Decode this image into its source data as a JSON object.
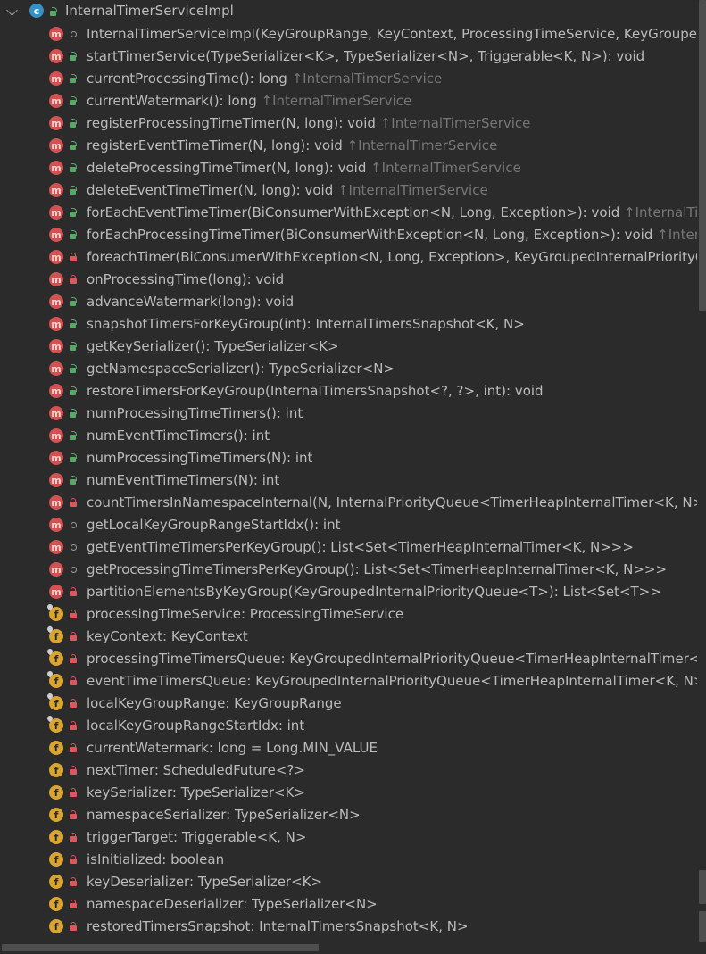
{
  "root": {
    "label": "InternalTimerServiceImpl",
    "icon": "class-icon",
    "icon_letter": "c"
  },
  "members": [
    {
      "kind": "m",
      "vis": "package",
      "sig": "InternalTimerServiceImpl(KeyGroupRange, KeyContext, ProcessingTimeService, KeyGroupedInt",
      "inh": ""
    },
    {
      "kind": "m",
      "vis": "public",
      "sig": "startTimerService(TypeSerializer<K>, TypeSerializer<N>, Triggerable<K, N>): void",
      "inh": ""
    },
    {
      "kind": "m",
      "vis": "public",
      "sig": "currentProcessingTime(): long ",
      "inh": "↑InternalTimerService"
    },
    {
      "kind": "m",
      "vis": "public",
      "sig": "currentWatermark(): long ",
      "inh": "↑InternalTimerService"
    },
    {
      "kind": "m",
      "vis": "public",
      "sig": "registerProcessingTimeTimer(N, long): void ",
      "inh": "↑InternalTimerService"
    },
    {
      "kind": "m",
      "vis": "public",
      "sig": "registerEventTimeTimer(N, long): void ",
      "inh": "↑InternalTimerService"
    },
    {
      "kind": "m",
      "vis": "public",
      "sig": "deleteProcessingTimeTimer(N, long): void ",
      "inh": "↑InternalTimerService"
    },
    {
      "kind": "m",
      "vis": "public",
      "sig": "deleteEventTimeTimer(N, long): void ",
      "inh": "↑InternalTimerService"
    },
    {
      "kind": "m",
      "vis": "public",
      "sig": "forEachEventTimeTimer(BiConsumerWithException<N, Long, Exception>): void ",
      "inh": "↑InternalTimerSe"
    },
    {
      "kind": "m",
      "vis": "public",
      "sig": "forEachProcessingTimeTimer(BiConsumerWithException<N, Long, Exception>): void ",
      "inh": "↑InternalTi"
    },
    {
      "kind": "m",
      "vis": "private",
      "sig": "foreachTimer(BiConsumerWithException<N, Long, Exception>, KeyGroupedInternalPriorityQue",
      "inh": ""
    },
    {
      "kind": "m",
      "vis": "private",
      "sig": "onProcessingTime(long): void",
      "inh": ""
    },
    {
      "kind": "m",
      "vis": "public",
      "sig": "advanceWatermark(long): void",
      "inh": ""
    },
    {
      "kind": "m",
      "vis": "public",
      "sig": "snapshotTimersForKeyGroup(int): InternalTimersSnapshot<K, N>",
      "inh": ""
    },
    {
      "kind": "m",
      "vis": "public",
      "sig": "getKeySerializer(): TypeSerializer<K>",
      "inh": ""
    },
    {
      "kind": "m",
      "vis": "public",
      "sig": "getNamespaceSerializer(): TypeSerializer<N>",
      "inh": ""
    },
    {
      "kind": "m",
      "vis": "public",
      "sig": "restoreTimersForKeyGroup(InternalTimersSnapshot<?, ?>, int): void",
      "inh": ""
    },
    {
      "kind": "m",
      "vis": "public",
      "sig": "numProcessingTimeTimers(): int",
      "inh": ""
    },
    {
      "kind": "m",
      "vis": "public",
      "sig": "numEventTimeTimers(): int",
      "inh": ""
    },
    {
      "kind": "m",
      "vis": "public",
      "sig": "numProcessingTimeTimers(N): int",
      "inh": ""
    },
    {
      "kind": "m",
      "vis": "public",
      "sig": "numEventTimeTimers(N): int",
      "inh": ""
    },
    {
      "kind": "m",
      "vis": "private",
      "sig": "countTimersInNamespaceInternal(N, InternalPriorityQueue<TimerHeapInternalTimer<K, N>>): i",
      "inh": ""
    },
    {
      "kind": "m",
      "vis": "package",
      "sig": "getLocalKeyGroupRangeStartIdx(): int",
      "inh": ""
    },
    {
      "kind": "m",
      "vis": "package",
      "sig": "getEventTimeTimersPerKeyGroup(): List<Set<TimerHeapInternalTimer<K, N>>>",
      "inh": ""
    },
    {
      "kind": "m",
      "vis": "package",
      "sig": "getProcessingTimeTimersPerKeyGroup(): List<Set<TimerHeapInternalTimer<K, N>>>",
      "inh": ""
    },
    {
      "kind": "m",
      "vis": "private",
      "sig": "partitionElementsByKeyGroup(KeyGroupedInternalPriorityQueue<T>): List<Set<T>>",
      "inh": ""
    },
    {
      "kind": "f",
      "pin": true,
      "vis": "private",
      "sig": "processingTimeService: ProcessingTimeService",
      "inh": ""
    },
    {
      "kind": "f",
      "pin": true,
      "vis": "private",
      "sig": "keyContext: KeyContext",
      "inh": ""
    },
    {
      "kind": "f",
      "pin": true,
      "vis": "private",
      "sig": "processingTimeTimersQueue: KeyGroupedInternalPriorityQueue<TimerHeapInternalTimer<K, N",
      "inh": ""
    },
    {
      "kind": "f",
      "pin": true,
      "vis": "private",
      "sig": "eventTimeTimersQueue: KeyGroupedInternalPriorityQueue<TimerHeapInternalTimer<K, N>>",
      "inh": ""
    },
    {
      "kind": "f",
      "pin": true,
      "vis": "private",
      "sig": "localKeyGroupRange: KeyGroupRange",
      "inh": ""
    },
    {
      "kind": "f",
      "pin": true,
      "vis": "private",
      "sig": "localKeyGroupRangeStartIdx: int",
      "inh": ""
    },
    {
      "kind": "f",
      "pin": false,
      "vis": "private",
      "sig": "currentWatermark: long = Long.MIN_VALUE",
      "inh": ""
    },
    {
      "kind": "f",
      "pin": false,
      "vis": "private",
      "sig": "nextTimer: ScheduledFuture<?>",
      "inh": ""
    },
    {
      "kind": "f",
      "pin": false,
      "vis": "private",
      "sig": "keySerializer: TypeSerializer<K>",
      "inh": ""
    },
    {
      "kind": "f",
      "pin": false,
      "vis": "private",
      "sig": "namespaceSerializer: TypeSerializer<N>",
      "inh": ""
    },
    {
      "kind": "f",
      "pin": false,
      "vis": "private",
      "sig": "triggerTarget: Triggerable<K, N>",
      "inh": ""
    },
    {
      "kind": "f",
      "pin": false,
      "vis": "private",
      "sig": "isInitialized: boolean",
      "inh": ""
    },
    {
      "kind": "f",
      "pin": false,
      "vis": "private",
      "sig": "keyDeserializer: TypeSerializer<K>",
      "inh": ""
    },
    {
      "kind": "f",
      "pin": false,
      "vis": "private",
      "sig": "namespaceDeserializer: TypeSerializer<N>",
      "inh": ""
    },
    {
      "kind": "f",
      "pin": false,
      "vis": "private",
      "sig": "restoredTimersSnapshot: InternalTimersSnapshot<K, N>",
      "inh": ""
    }
  ],
  "colors": {
    "background": "#2b2b2b",
    "text": "#bbbbbb",
    "inherited": "#767676",
    "method": "#d25252",
    "field": "#d9a430",
    "public": "#59a869",
    "private": "#db5860"
  }
}
